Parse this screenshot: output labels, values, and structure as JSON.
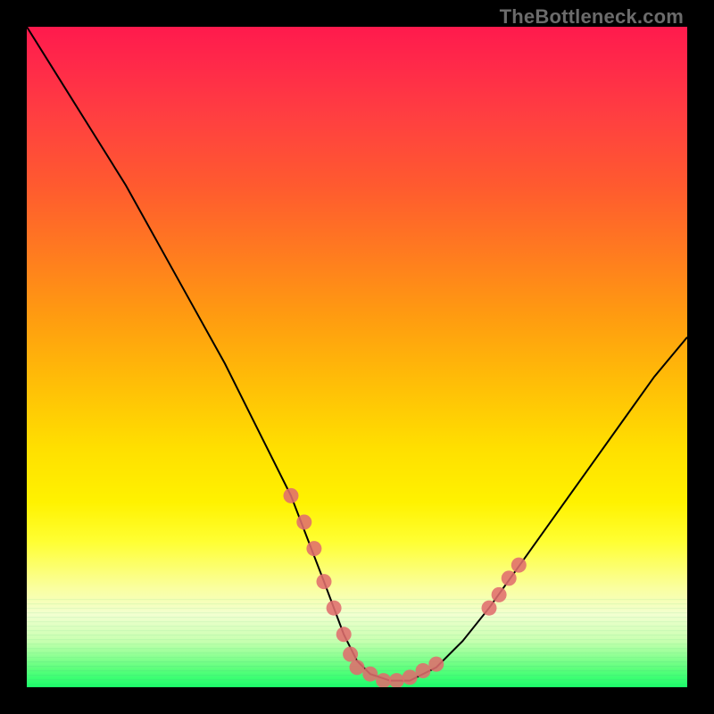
{
  "watermark": {
    "text": "TheBottleneck.com"
  },
  "colors": {
    "frame_background": "#000000",
    "curve_stroke": "#000000",
    "dot_fill": "#e06d6d",
    "dot_stroke": "#e06d6d",
    "gradient": {
      "top": "#ff1a4d",
      "mid": "#ffe000",
      "bottom": "#1aff6a"
    }
  },
  "chart_data": {
    "type": "line",
    "title": "",
    "xlabel": "",
    "ylabel": "",
    "xlim": [
      0,
      100
    ],
    "ylim": [
      0,
      100
    ],
    "annotations": [],
    "series": [
      {
        "name": "bottleneck-curve",
        "x": [
          0,
          5,
          10,
          15,
          20,
          25,
          30,
          35,
          40,
          45,
          48,
          50,
          52,
          55,
          58,
          62,
          66,
          70,
          75,
          80,
          85,
          90,
          95,
          100
        ],
        "values": [
          100,
          92,
          84,
          76,
          67,
          58,
          49,
          39,
          29,
          16,
          8,
          4,
          2,
          1,
          1,
          3,
          7,
          12,
          19,
          26,
          33,
          40,
          47,
          53
        ]
      }
    ],
    "dots": {
      "name": "highlight-dots",
      "points": [
        {
          "x": 40,
          "y": 29
        },
        {
          "x": 42,
          "y": 25
        },
        {
          "x": 43.5,
          "y": 21
        },
        {
          "x": 45,
          "y": 16
        },
        {
          "x": 46.5,
          "y": 12
        },
        {
          "x": 48,
          "y": 8
        },
        {
          "x": 49,
          "y": 5
        },
        {
          "x": 50,
          "y": 3
        },
        {
          "x": 52,
          "y": 2
        },
        {
          "x": 54,
          "y": 1
        },
        {
          "x": 56,
          "y": 1
        },
        {
          "x": 58,
          "y": 1.5
        },
        {
          "x": 60,
          "y": 2.5
        },
        {
          "x": 62,
          "y": 3.5
        },
        {
          "x": 70,
          "y": 12
        },
        {
          "x": 71.5,
          "y": 14
        },
        {
          "x": 73,
          "y": 16.5
        },
        {
          "x": 74.5,
          "y": 18.5
        }
      ]
    }
  }
}
